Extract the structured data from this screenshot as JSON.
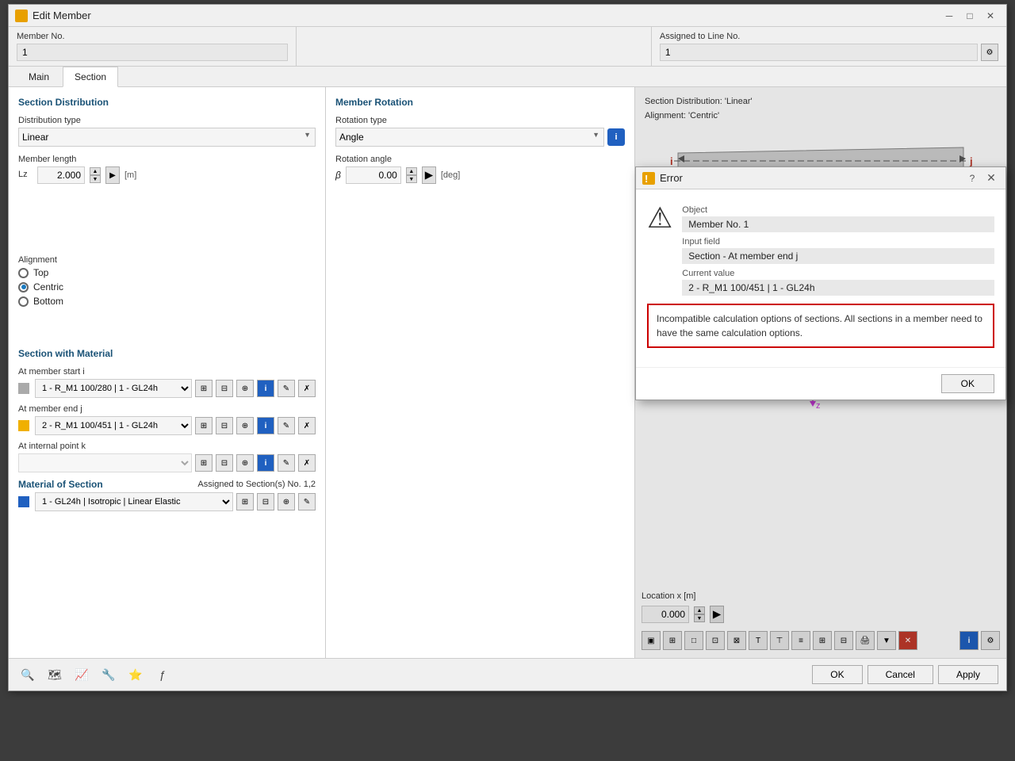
{
  "window": {
    "title": "Edit Member",
    "icon": "✦"
  },
  "top_fields": {
    "member_no_label": "Member No.",
    "member_no_value": "1",
    "assigned_line_label": "Assigned to Line No.",
    "assigned_line_value": "1"
  },
  "tabs": [
    {
      "label": "Main",
      "active": false
    },
    {
      "label": "Section",
      "active": true
    }
  ],
  "left_panel": {
    "section_distribution_header": "Section Distribution",
    "distribution_type_label": "Distribution type",
    "distribution_type_value": "Linear",
    "member_length_label": "Member length",
    "lz_label": "Lz",
    "lz_value": "2.000",
    "lz_unit": "[m]",
    "alignment_label": "Alignment",
    "alignment_options": [
      {
        "label": "Top",
        "checked": false
      },
      {
        "label": "Centric",
        "checked": true
      },
      {
        "label": "Bottom",
        "checked": false
      }
    ],
    "section_material_header": "Section with Material",
    "at_start_label": "At member start i",
    "at_start_value": "1 - R_M1 100/280 | 1 - GL24h",
    "at_end_label": "At member end j",
    "at_end_value": "2 - R_M1 100/451 | 1 - GL24h",
    "at_internal_label": "At internal point k",
    "at_internal_value": "",
    "material_header": "Material of Section",
    "material_assigned_label": "Assigned to Section(s) No. 1,2",
    "material_value": "1 - GL24h | Isotropic | Linear Elastic"
  },
  "middle_panel": {
    "member_rotation_header": "Member Rotation",
    "rotation_type_label": "Rotation type",
    "rotation_type_value": "Angle",
    "rotation_angle_label": "Rotation angle",
    "beta_label": "β",
    "beta_value": "0.00",
    "beta_unit": "[deg]"
  },
  "right_panel": {
    "info_line1": "Section Distribution: 'Linear'",
    "info_line2": "Alignment: 'Centric'",
    "location_label": "Location x [m]",
    "location_value": "0.000"
  },
  "error_dialog": {
    "title": "Error",
    "help_label": "?",
    "object_label": "Object",
    "object_value": "Member No. 1",
    "input_field_label": "Input field",
    "input_field_value": "Section - At member end j",
    "current_value_label": "Current value",
    "current_value_value": "2 - R_M1 100/451 | 1 - GL24h",
    "error_message": "Incompatible calculation options of sections. All sections in a member need to have the same calculation options.",
    "ok_label": "OK"
  },
  "bottom_bar": {
    "ok_label": "OK",
    "cancel_label": "Cancel",
    "apply_label": "Apply"
  },
  "icons": {
    "warning": "⚠",
    "close": "✕",
    "minimize": "─",
    "maximize": "□",
    "info": "i",
    "gear": "⚙",
    "arrow_right": "▶",
    "arrow_up": "▲",
    "arrow_down": "▼",
    "chevron_down": "▾"
  }
}
